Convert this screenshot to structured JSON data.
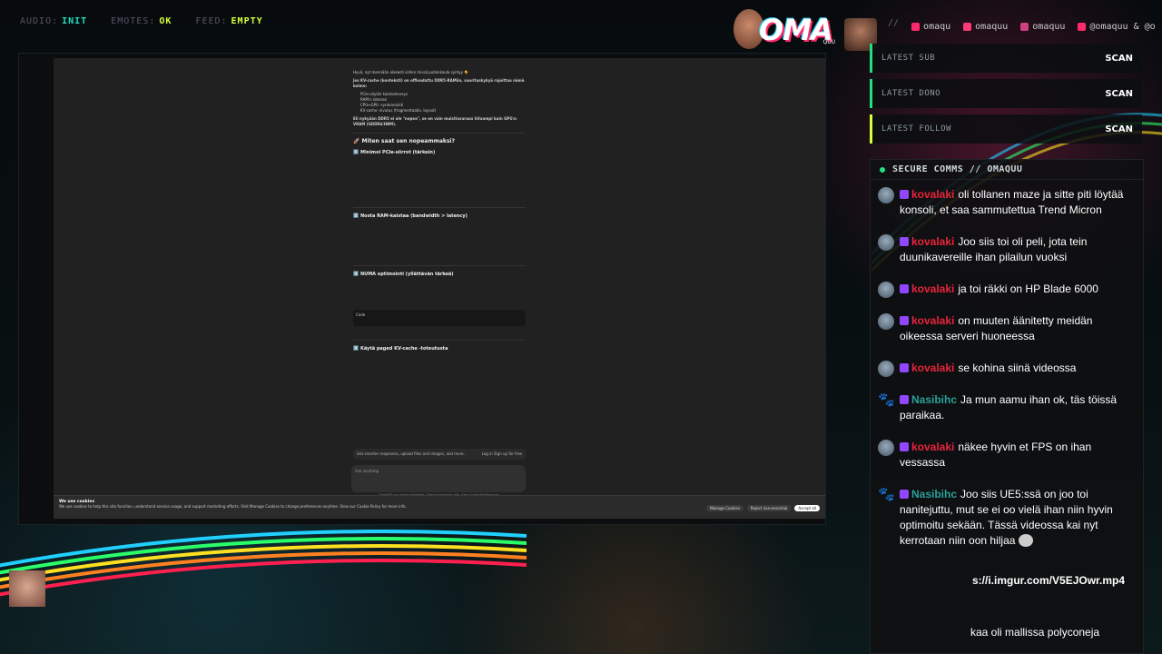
{
  "status": {
    "audio_label": "AUDIO:",
    "audio_value": "INIT",
    "emotes_label": "EMOTES:",
    "emotes_value": "OK",
    "feed_label": "FEED:",
    "feed_value": "EMPTY"
  },
  "logo": {
    "text": "OMA",
    "sub": "QUU"
  },
  "socials": {
    "separator": "//",
    "items": [
      {
        "icon": "youtube-icon",
        "label": "omaqu"
      },
      {
        "icon": "twitch-icon",
        "label": "omaquu"
      },
      {
        "icon": "instagram-icon",
        "label": "omaquu"
      },
      {
        "icon": "youtube-icon",
        "label": "@omaquu & @o"
      }
    ]
  },
  "stats": [
    {
      "label": "LATEST SUB",
      "value": "SCAN"
    },
    {
      "label": "LATEST DONO",
      "value": "SCAN"
    },
    {
      "label": "LATEST FOLLOW",
      "value": "SCAN"
    }
  ],
  "chat": {
    "header": "SECURE COMMS // OMAQUU",
    "messages": [
      {
        "user": "kovalaki",
        "text": "oli tollanen maze ja sitte piti löytää konsoli, et saa sammutettua Trend Micron"
      },
      {
        "user": "kovalaki",
        "text": "Joo siis toi oli peli, jota tein duunikavereille ihan pilailun vuoksi"
      },
      {
        "user": "kovalaki",
        "text": "ja toi räkki on HP Blade 6000"
      },
      {
        "user": "kovalaki",
        "text": "on muuten äänitetty meidän oikeessa serveri huoneessa"
      },
      {
        "user": "kovalaki",
        "text": "se kohina siinä videossa"
      },
      {
        "user": "Nasibihc",
        "text": "Ja mun aamu ihan ok, täs töissä paraikaa."
      },
      {
        "user": "kovalaki",
        "text": "näkee hyvin et FPS on ihan vessassa"
      },
      {
        "user": "Nasibihc",
        "text": "Joo siis UE5:ssä on joo toi nanitejuttu, mut se ei oo vielä ihan niin hyvin optimoitu sekään. Tässä videossa kai nyt kerrotaan niin oon hiljaa"
      }
    ],
    "link": "s://i.imgur.com/V5EJOwr.mp4",
    "last": "kaa oli mallissa polyconeja"
  },
  "browser": {
    "intro": "Hyvä, nyt mennään oikeasti siihen missä pullonkaula syntyy 👇",
    "intro2": "Jos KV-cache (konteksti) on offloadattu DDR5-RAMiin, suorituskykyä rajoittaa nämä kolme:",
    "bullets": [
      "PCIe-väylän kaistanleveys",
      "RAM:n latenssi",
      "CPU↔GPU -synkronointi",
      "KV-cache -sivutus (fragmentaatio, layout)"
    ],
    "note": "Eli nykyään DDR5 ei ole \"nopea\", se on vain muistiavaruus hitaampi kuin GPU:n VRAM (GDDR6/HBM).",
    "h1": "🚀 Miten saat sen nopeammaksi?",
    "h2": "1️⃣ Minimoi PCIe-siirrot (tärkein)",
    "h3": "2️⃣ Nosta RAM-kaistaa (bandwidth > latency)",
    "h4": "3️⃣ NUMA optimointi (yllättävän tärkeä)",
    "h5": "4️⃣ Käytä paged KV-cache -toteutusta",
    "code_label": "Code",
    "suggestion": "Get smarter responses, upload files and images, and more.",
    "login": "Log in",
    "signup": "Sign up for free",
    "placeholder": "Ask anything",
    "disclaimer": "ChatGPT can make mistakes. Check important info. See Cookie Preferences.",
    "cookie_title": "We use cookies",
    "cookie_text": "We use cookies to help this site function, understand service usage, and support marketing efforts. Visit Manage Cookies to change preferences anytime. View our Cookie Policy for more info.",
    "cookie_manage": "Manage Cookies",
    "cookie_reject": "Reject non-essential",
    "cookie_accept": "Accept all"
  }
}
